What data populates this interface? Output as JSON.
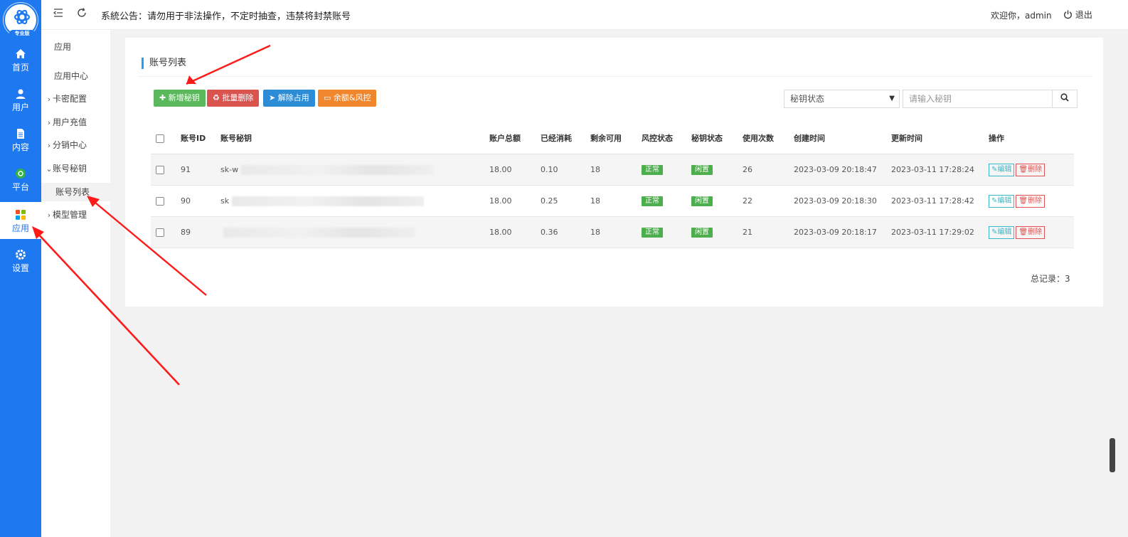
{
  "topbar": {
    "notice": "系統公告：请勿用于非法操作，不定时抽查，违禁将封禁账号",
    "welcome": "欢迎你，admin",
    "logout": "退出"
  },
  "logo": {
    "badge": "专业版"
  },
  "rail": [
    {
      "label": "首页",
      "icon": "home-icon"
    },
    {
      "label": "用户",
      "icon": "user-icon"
    },
    {
      "label": "内容",
      "icon": "document-icon"
    },
    {
      "label": "平台",
      "icon": "platform-icon"
    },
    {
      "label": "应用",
      "icon": "apps-icon"
    },
    {
      "label": "设置",
      "icon": "gear-icon"
    }
  ],
  "submenu": {
    "title": "应用",
    "items": [
      "应用中心",
      "卡密配置",
      "用户充值",
      "分销中心",
      "账号秘钥",
      "账号列表",
      "模型管理"
    ]
  },
  "card": {
    "title": "账号列表",
    "buttons": [
      "新增秘钥",
      "批量删除",
      "解除占用",
      "余额&风控"
    ],
    "status_select": "秘钥状态",
    "search_placeholder": "请输入秘钥"
  },
  "table": {
    "headers": [
      "账号ID",
      "账号秘钥",
      "账户总额",
      "已经消耗",
      "剩余可用",
      "风控状态",
      "秘钥状态",
      "使用次数",
      "创建时间",
      "更新时间",
      "操作"
    ],
    "rows": [
      {
        "id": "91",
        "key": "sk-w",
        "total": "18.00",
        "used": "0.10",
        "remain": "18",
        "risk": "正常",
        "status": "闲置",
        "count": "26",
        "created": "2023-03-09 20:18:47",
        "updated": "2023-03-11 17:28:24"
      },
      {
        "id": "90",
        "key": "sk",
        "total": "18.00",
        "used": "0.25",
        "remain": "18",
        "risk": "正常",
        "status": "闲置",
        "count": "22",
        "created": "2023-03-09 20:18:30",
        "updated": "2023-03-11 17:28:42"
      },
      {
        "id": "89",
        "key": "",
        "total": "18.00",
        "used": "0.36",
        "remain": "18",
        "risk": "正常",
        "status": "闲置",
        "count": "21",
        "created": "2023-03-09 20:18:17",
        "updated": "2023-03-11 17:29:02"
      }
    ],
    "edit_label": "编辑",
    "delete_label": "删除"
  },
  "total": "总记录：3",
  "colors": {
    "primary": "#1e78f0",
    "green": "#5cb85c",
    "red": "#d9534f",
    "blue": "#2d8cd6",
    "orange": "#f0862d",
    "annotation": "#ff1a1a"
  }
}
